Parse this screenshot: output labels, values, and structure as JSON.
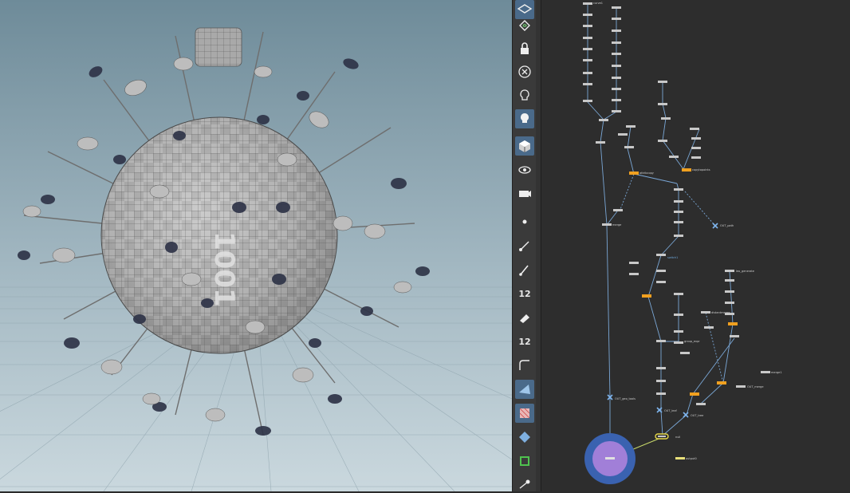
{
  "viewport": {
    "bg_top": "#6f8c9a",
    "bg_bottom": "#c7d6dd",
    "model_color": "#9a9a9a",
    "leaf_dark": "#2f3448",
    "leaf_light": "#bdbdbd",
    "sphere_texture_text": "1001"
  },
  "toolbar": {
    "tools": [
      {
        "name": "tool-display-options",
        "icon": "layers-icon"
      },
      {
        "name": "tool-ghost",
        "icon": "spiral-icon"
      },
      {
        "name": "tool-lock",
        "icon": "lock-icon"
      },
      {
        "name": "tool-hide",
        "icon": "x-circle-icon"
      },
      {
        "name": "tool-light",
        "icon": "bulb-outline-icon"
      },
      {
        "name": "tool-light-on",
        "icon": "bulb-icon"
      },
      {
        "name": "tool-shading",
        "icon": "cube-icon"
      },
      {
        "name": "tool-camera",
        "icon": "eye-camera-icon"
      },
      {
        "name": "tool-camera-settings",
        "icon": "camera-icon"
      },
      {
        "name": "tool-point",
        "icon": "point-icon"
      },
      {
        "name": "tool-vector",
        "icon": "vector-icon"
      },
      {
        "name": "tool-brush",
        "icon": "brush-icon"
      },
      {
        "name": "tool-number",
        "label": "12",
        "icon": "point-number-icon"
      },
      {
        "name": "tool-paint",
        "icon": "paint-icon"
      },
      {
        "name": "tool-prim-number",
        "label": "12",
        "icon": "prim-number-icon"
      },
      {
        "name": "tool-curve",
        "icon": "curve-icon"
      },
      {
        "name": "tool-snap",
        "icon": "snap-icon"
      },
      {
        "name": "tool-uv",
        "icon": "uv-grid-icon"
      },
      {
        "name": "tool-template",
        "icon": "diamond-icon"
      },
      {
        "name": "tool-wire",
        "icon": "wire-icon"
      },
      {
        "name": "tool-transform",
        "icon": "transform-icon"
      }
    ],
    "number_label_a": "12",
    "number_label_b": "12"
  },
  "network": {
    "labels": {
      "geo_tools": "OUT_geo_tools",
      "out_path": "OUT_path",
      "out_leaf": "OUT_leaf",
      "out_tree": "OUT_tree",
      "geo_generate": "leo_generate",
      "merge_out": "OUT_merge",
      "output": "output0",
      "attrib_copy": "attribcopy",
      "copy_to_points": "copytopoints",
      "merge": "merge",
      "null_out": "null",
      "distant": "distantmerge",
      "switch": "switch1",
      "merge1": "merge1",
      "group": "group_expr",
      "curve": "curve1"
    },
    "colors": {
      "wire": "#7aa7d6",
      "node": "#c8c8c8",
      "node_orange": "#f0a020",
      "display_flag": "#e6d84a",
      "selected_circle": "#3a62b0",
      "selected_inner": "#a17fd8"
    }
  }
}
